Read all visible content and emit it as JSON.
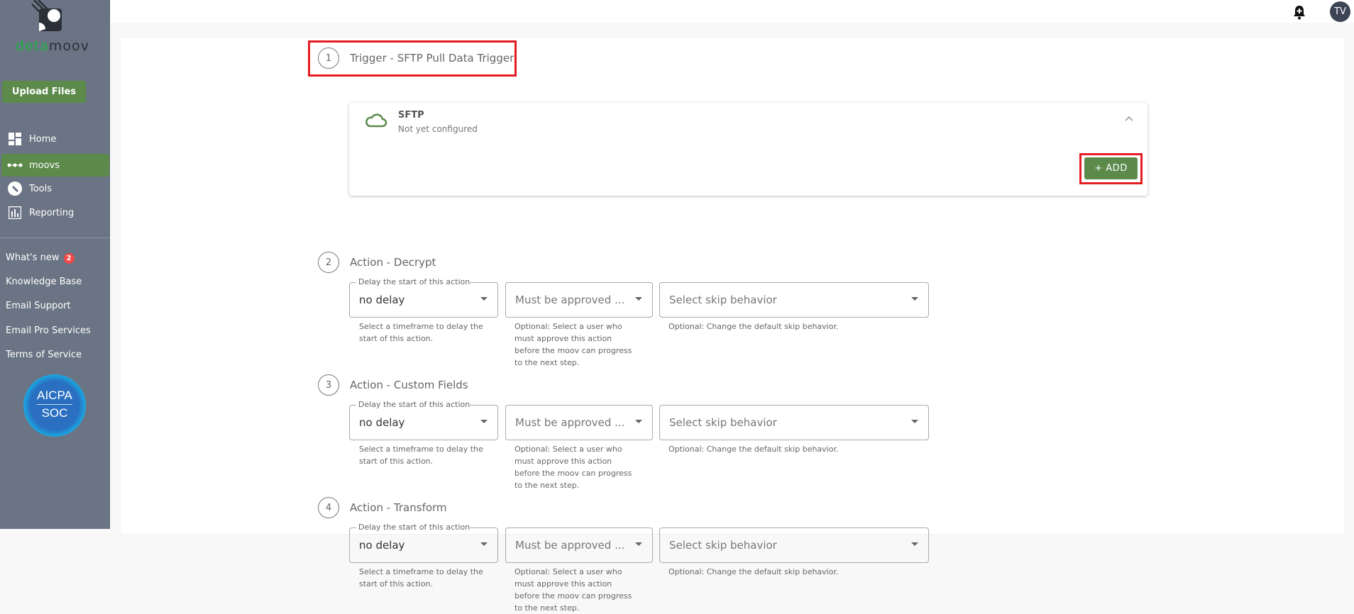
{
  "sidebar": {
    "logo": "detamoov",
    "logo_parts": [
      "deta",
      "moov"
    ],
    "upload_label": "Upload Files",
    "nav": [
      {
        "label": "Home",
        "icon": "dashboard-icon"
      },
      {
        "label": "moovs",
        "icon": "moovs-dots-icon",
        "active": true
      },
      {
        "label": "Tools",
        "icon": "wrench-icon"
      },
      {
        "label": "Reporting",
        "icon": "bar-chart-icon"
      }
    ],
    "links": [
      {
        "label": "What's new",
        "badge": "2"
      },
      {
        "label": "Knowledge Base"
      },
      {
        "label": "Email Support"
      },
      {
        "label": "Email Pro Services"
      },
      {
        "label": "Terms of Service"
      }
    ],
    "soc_badge": {
      "title": "AICPA",
      "subtitle": "SOC"
    }
  },
  "topbar": {
    "avatar": "TV",
    "bell_icon": "bell-plus-icon"
  },
  "colors": {
    "accent": "#5b8a4b",
    "highlight": "#e51c23",
    "sidebar": "#6b7484"
  },
  "steps": [
    {
      "num": "1",
      "label": "Trigger - SFTP Pull Data Trigger",
      "card": {
        "title": "SFTP",
        "status": "Not yet configured",
        "add_label": "+ ADD"
      }
    },
    {
      "num": "2",
      "label": "Action - Decrypt"
    },
    {
      "num": "3",
      "label": "Action - Custom Fields"
    },
    {
      "num": "4",
      "label": "Action - Transform"
    }
  ],
  "fields": {
    "delay_legend": "Delay the start of this action",
    "delay_value": "no delay",
    "delay_help": "Select a timeframe to delay the start of this action.",
    "approve_placeholder": "Must be approved ...",
    "approve_help": "Optional: Select a user who must approve this action before the moov can progress to the next step.",
    "skip_placeholder": "Select skip behavior",
    "skip_help": "Optional: Change the default skip behavior."
  }
}
